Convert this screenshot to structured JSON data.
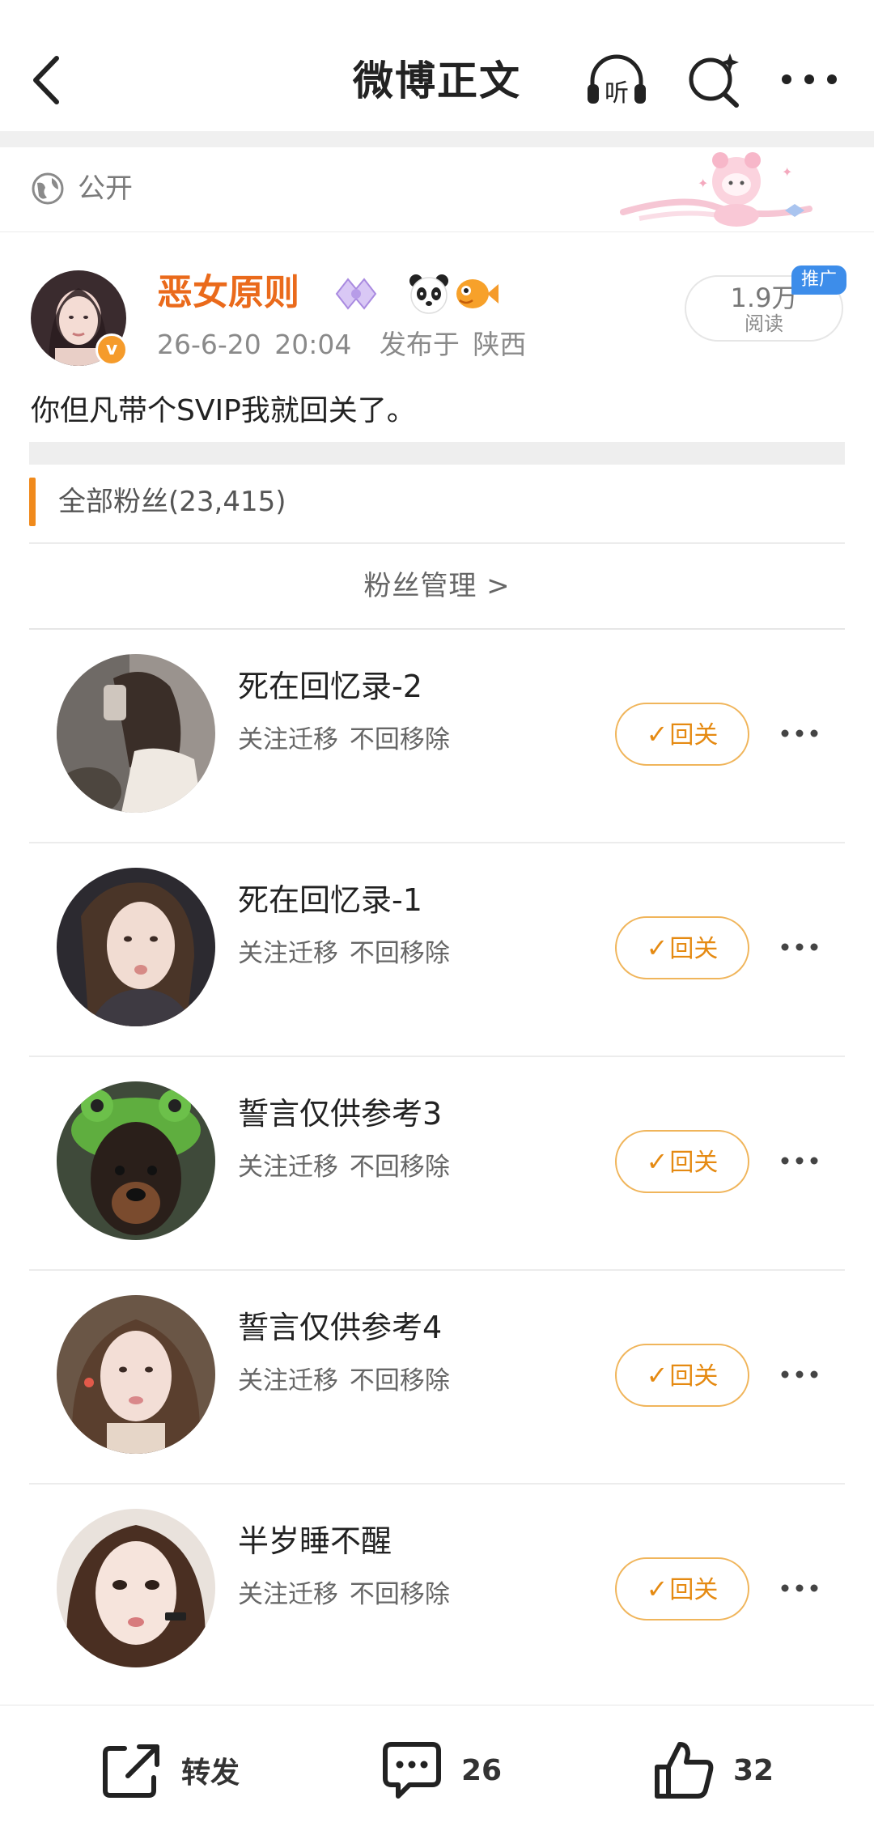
{
  "header": {
    "title": "微博正文",
    "listen_label": "听"
  },
  "visibility": {
    "label": "公开"
  },
  "post": {
    "author": "恶女原则",
    "verified_mark": "v",
    "timestamp": "26-6-20 20:04",
    "location": "发布于 陕西",
    "reads_count": "1.9万",
    "reads_label": "阅读",
    "promo_tag": "推广",
    "text": "你但凡带个SVIP我就回关了。"
  },
  "fans": {
    "title": "全部粉丝(23,415)",
    "manage_label": "粉丝管理  >",
    "items": [
      {
        "name": "死在回忆录-2",
        "subtitle": "关注迁移 不回移除",
        "follow_label": "回关"
      },
      {
        "name": "死在回忆录-1",
        "subtitle": "关注迁移 不回移除",
        "follow_label": "回关"
      },
      {
        "name": "誓言仅供参考3",
        "subtitle": "关注迁移 不回移除",
        "follow_label": "回关"
      },
      {
        "name": "誓言仅供参考4",
        "subtitle": "关注迁移 不回移除",
        "follow_label": "回关"
      },
      {
        "name": "半岁睡不醒",
        "subtitle": "关注迁移 不回移除",
        "follow_label": "回关"
      }
    ]
  },
  "bottom_bar": {
    "repost_label": "转发",
    "comment_count": "26",
    "like_count": "32"
  },
  "colors": {
    "accent_orange": "#ea6a1b",
    "follow_orange": "#e58a12",
    "promo_blue": "#3d8dea"
  }
}
